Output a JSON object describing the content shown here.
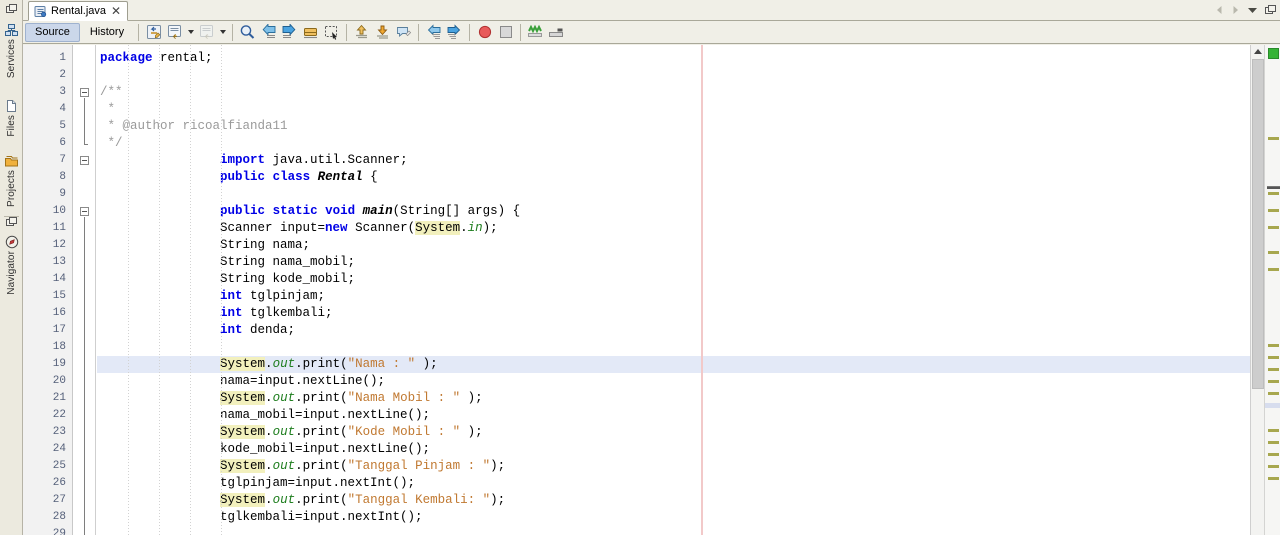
{
  "window": {
    "left_strip": {
      "top_icon": "window-icon",
      "tabs": [
        {
          "label": "Services",
          "icon": "services-icon"
        },
        {
          "label": "Files",
          "icon": "files-icon"
        },
        {
          "label": "Projects",
          "icon": "projects-icon"
        }
      ],
      "bottom_icon": "window-icon",
      "bottom_tabs": [
        {
          "label": "Navigator",
          "icon": "navigator-icon"
        }
      ]
    },
    "tab": {
      "filename": "Rental.java",
      "file_icon": "java-file-icon",
      "close_label": "✕"
    },
    "tab_right_controls": [
      {
        "name": "scroll-left-button",
        "glyph": "◀"
      },
      {
        "name": "scroll-right-button",
        "glyph": "▶"
      },
      {
        "name": "show-opened-documents-button",
        "glyph": "▼"
      },
      {
        "name": "restore-window-button",
        "glyph": "❐"
      }
    ],
    "maximize_glyph": "✥"
  },
  "toolbar": {
    "source_label": "Source",
    "history_label": "History",
    "buttons": [
      {
        "name": "last-edit-button",
        "icon": "last-edit-icon"
      },
      {
        "name": "back-button",
        "icon": "navigate-back-icon"
      },
      {
        "name": "back-dropdown",
        "icon": "chevron-down-icon"
      },
      {
        "name": "forward-button",
        "icon": "navigate-forward-icon"
      },
      {
        "name": "forward-dropdown",
        "icon": "chevron-down-icon"
      },
      {
        "name": "find-selection-button",
        "icon": "magnifier-icon"
      },
      {
        "name": "previous-bookmark-button",
        "icon": "arrow-left-bookmark-icon"
      },
      {
        "name": "next-bookmark-button",
        "icon": "arrow-right-bookmark-icon"
      },
      {
        "name": "toggle-bookmark-button",
        "icon": "bookmark-icon"
      },
      {
        "name": "toggle-rectangular-selection-button",
        "icon": "rectangular-selection-icon"
      },
      {
        "name": "shift-line-up-button",
        "icon": "arrow-up-icon"
      },
      {
        "name": "shift-line-down-button",
        "icon": "arrow-down-icon"
      },
      {
        "name": "comment-button",
        "icon": "comment-icon"
      },
      {
        "name": "previous-error-button",
        "icon": "arrow-left-error-icon"
      },
      {
        "name": "next-error-button",
        "icon": "arrow-right-error-icon"
      },
      {
        "name": "toggle-breakpoint-button",
        "icon": "breakpoint-red-circle-icon"
      },
      {
        "name": "stop-button",
        "icon": "stop-square-icon"
      },
      {
        "name": "inspect-button",
        "icon": "inspect-green-icon"
      },
      {
        "name": "format-button",
        "icon": "format-icon"
      }
    ]
  },
  "editor": {
    "current_line": 19,
    "first_line": 1,
    "last_line": 29,
    "right_margin_column": 80,
    "scrollbar": {
      "thumb_top_pct": 3,
      "thumb_height_pct": 68
    },
    "error_stripe_status": "ok",
    "lines": [
      {
        "n": 1,
        "html": "<span class=\"kw\">package</span> rental;"
      },
      {
        "n": 2,
        "html": ""
      },
      {
        "n": 3,
        "html": "<span class=\"cmt\">/**</span>"
      },
      {
        "n": 4,
        "html": "<span class=\"cmt\"> *</span>"
      },
      {
        "n": 5,
        "html": "<span class=\"cmt\"> * @author ricoalfianda11</span>"
      },
      {
        "n": 6,
        "html": "<span class=\"cmt\"> */</span>"
      },
      {
        "n": 7,
        "html": "                <span class=\"kw\">import</span> java.util.Scanner;"
      },
      {
        "n": 8,
        "html": "                <span class=\"kw\">public</span> <span class=\"kw\">class</span> <span class=\"mth\">Rental</span> {"
      },
      {
        "n": 9,
        "html": ""
      },
      {
        "n": 10,
        "html": "                <span class=\"kw\">public</span> <span class=\"kw\">static</span> <span class=\"kw\">void</span> <span class=\"mth\">main</span>(String[] args) {"
      },
      {
        "n": 11,
        "html": "                Scanner input=<span class=\"kw\">new</span> Scanner(<span class=\"hl\">System</span>.<span class=\"fld\">in</span>);"
      },
      {
        "n": 12,
        "html": "                String nama;"
      },
      {
        "n": 13,
        "html": "                String nama_mobil;"
      },
      {
        "n": 14,
        "html": "                String kode_mobil;"
      },
      {
        "n": 15,
        "html": "                <span class=\"kw\">int</span> tglpinjam;"
      },
      {
        "n": 16,
        "html": "                <span class=\"kw\">int</span> tglkembali;"
      },
      {
        "n": 17,
        "html": "                <span class=\"kw\">int</span> denda;"
      },
      {
        "n": 18,
        "html": ""
      },
      {
        "n": 19,
        "html": "                <span class=\"hl\">System</span>.<span class=\"fld\">out</span>.print(<span class=\"str\">\"Nama : \"</span> );"
      },
      {
        "n": 20,
        "html": "                nama=input.nextLine();"
      },
      {
        "n": 21,
        "html": "                <span class=\"hl\">System</span>.<span class=\"fld\">out</span>.print(<span class=\"str\">\"Nama Mobil : \"</span> );"
      },
      {
        "n": 22,
        "html": "                nama_mobil=input.nextLine();"
      },
      {
        "n": 23,
        "html": "                <span class=\"hl\">System</span>.<span class=\"fld\">out</span>.print(<span class=\"str\">\"Kode Mobil : \"</span> );"
      },
      {
        "n": 24,
        "html": "                kode_mobil=input.nextLine();"
      },
      {
        "n": 25,
        "html": "                <span class=\"hl\">System</span>.<span class=\"fld\">out</span>.print(<span class=\"str\">\"Tanggal Pinjam : \"</span>);"
      },
      {
        "n": 26,
        "html": "                tglpinjam=input.nextInt();"
      },
      {
        "n": 27,
        "html": "                <span class=\"hl\">System</span>.<span class=\"fld\">out</span>.print(<span class=\"str\">\"Tanggal Kembali: \"</span>);"
      },
      {
        "n": 28,
        "html": "                tglkembali=input.nextInt();"
      },
      {
        "n": 29,
        "html": ""
      }
    ],
    "plain_text_lines": [
      "package rental;",
      "",
      "/**",
      " *",
      " * @author ricoalfianda11",
      " */",
      "import java.util.Scanner;",
      "public class Rental {",
      "",
      "public static void main(String[] args) {",
      "Scanner input=new Scanner(System.in);",
      "String nama;",
      "String nama_mobil;",
      "String kode_mobil;",
      "int tglpinjam;",
      "int tglkembali;",
      "int denda;",
      "",
      "System.out.print(\"Nama : \" );",
      "nama=input.nextLine();",
      "System.out.print(\"Nama Mobil : \" );",
      "nama_mobil=input.nextLine();",
      "System.out.print(\"Kode Mobil : \" );",
      "kode_mobil=input.nextLine();",
      "System.out.print(\"Tanggal Pinjam : \");",
      "tglpinjam=input.nextInt();",
      "System.out.print(\"Tanggal Kembali: \");",
      "tglkembali=input.nextInt();",
      ""
    ],
    "fold_markers": [
      3,
      7,
      10
    ],
    "colors": {
      "keyword": "#0000e6",
      "comment": "#9a9a9a",
      "string": "#c07830",
      "static_field": "#1d7d1d",
      "occurrence_highlight": "#f2f0bd",
      "current_line": "#e3e9f7",
      "right_margin": "#f2c9c9",
      "stripe_mark": "#a7a74e",
      "stripe_ok": "#36b336"
    }
  }
}
